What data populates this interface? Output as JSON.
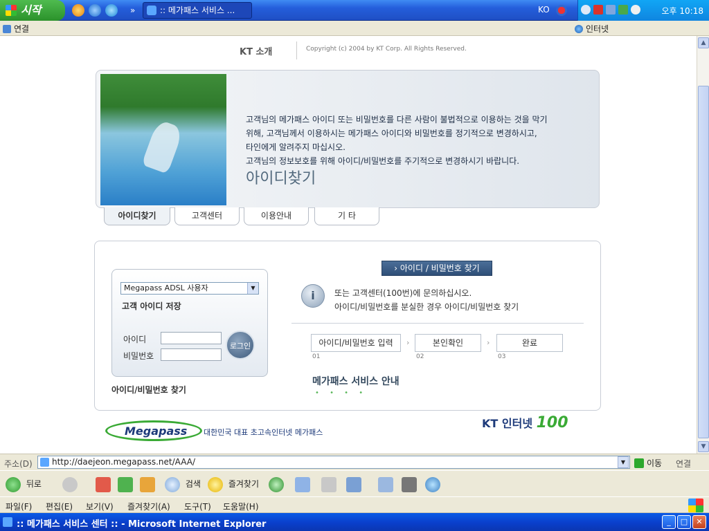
{
  "taskbar": {
    "start_label": "시작",
    "task_title": ":: 메가패스 서비스 ...",
    "lang": "KO",
    "clock": "오후 10:18",
    "chevron": "»"
  },
  "linksbar": {
    "label": "연결",
    "internet": "인터넷"
  },
  "header": {
    "kt_logo": "KT 소개",
    "copyright": "Copyright (c) 2004 by KT Corp. All Rights Reserved."
  },
  "banner": {
    "title": "아이디찾기",
    "lines": [
      "고객님의 메가패스 아이디 또는 비밀번호를 다른 사람이 불법적으로 이용하는 것을 막기",
      "위해, 고객님께서 이용하시는 메가패스 아이디와 비밀번호를 정기적으로 변경하시고,",
      "타인에게 알려주지 마십시오.",
      "고객님의 정보보호를 위해 아이디/비밀번호를 주기적으로 변경하시기 바랍니다."
    ]
  },
  "tabs": [
    "아이디찾기",
    "고객센터",
    "이용안내",
    "기 타"
  ],
  "login": {
    "service_select": "Megapass ADSL 사용자",
    "save_id": "고객 아이디 저장",
    "id_label": "아이디",
    "pw_label": "비밀번호",
    "login_button": "로그인",
    "find_link": "아이디/비밀번호 찾기"
  },
  "find": {
    "button": "› 아이디 / 비밀번호 찾기",
    "info_icon": "i",
    "info_line1": "또는 고객센터(100번)에 문의하십시오.",
    "info_line2": "아이디/비밀번호를 분실한 경우 아이디/비밀번호 찾기",
    "steps": [
      {
        "label": "아이디/비밀번호 입력",
        "num": "01"
      },
      {
        "label": "본인확인",
        "num": "02"
      },
      {
        "label": "완료",
        "num": "03"
      }
    ],
    "step_arrow": "›",
    "guide_title": "메가패스 서비스 안내",
    "guide_dots": "• • • •"
  },
  "footer": {
    "megapass_logo": "Megapass",
    "megapass_tag": "대한민국 대표 초고속인터넷 메가패스",
    "kt_internet_prefix": "KT 인터넷",
    "kt_internet_num": "100"
  },
  "addressbar": {
    "label": "주소(D)",
    "url": "http://daejeon.megapass.net/AAA/",
    "go": "이동",
    "links": "연결"
  },
  "toolbar": {
    "back": "뒤로",
    "search": "검색",
    "favorites": "즐겨찾기"
  },
  "menubar": [
    "파일(F)",
    "편집(E)",
    "보기(V)",
    "즐겨찾기(A)",
    "도구(T)",
    "도움말(H)"
  ],
  "titlebar": {
    "title": ":: 메가패스 서비스 센터 :: - Microsoft Internet Explorer",
    "minimize": "_",
    "maximize": "□",
    "close": "✕"
  },
  "colors": {
    "taskbar": "#245edb",
    "start": "#2b922b",
    "accent_navy": "#1d3a7a",
    "accent_green": "#3aaa35"
  }
}
